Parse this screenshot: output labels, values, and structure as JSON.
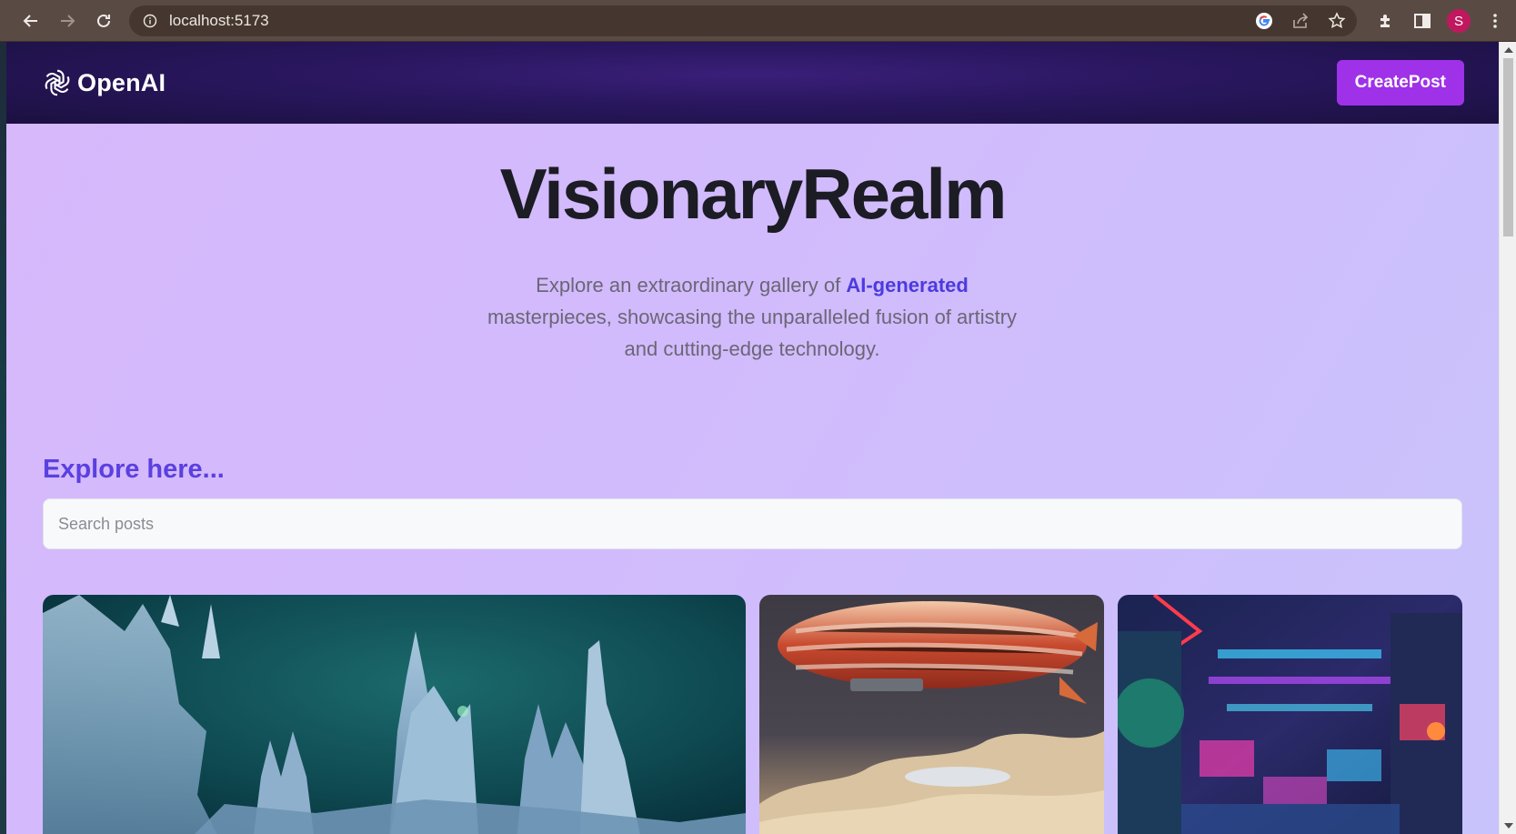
{
  "browser": {
    "url": "localhost:5173",
    "profile_initial": "S"
  },
  "header": {
    "logo_text": "OpenAI",
    "create_button": "CreatePost"
  },
  "hero": {
    "title": "VisionaryRealm",
    "subtitle_before": "Explore an extraordinary gallery of ",
    "subtitle_highlight": "AI-generated",
    "subtitle_after": " masterpieces, showcasing the unparalleled fusion of artistry and cutting-edge technology."
  },
  "explore": {
    "heading": "Explore here...",
    "search_placeholder": "Search posts",
    "search_value": ""
  },
  "gallery": {
    "cards": [
      {
        "subject": "crystal-castle-image"
      },
      {
        "subject": "airship-image"
      },
      {
        "subject": "neon-city-image"
      }
    ]
  },
  "colors": {
    "header_bg": "#2a1760",
    "create_button": "#9f32e8",
    "accent": "#5a40e0",
    "highlight": "#4b3bde",
    "page_bg": "#d2bbfc"
  }
}
